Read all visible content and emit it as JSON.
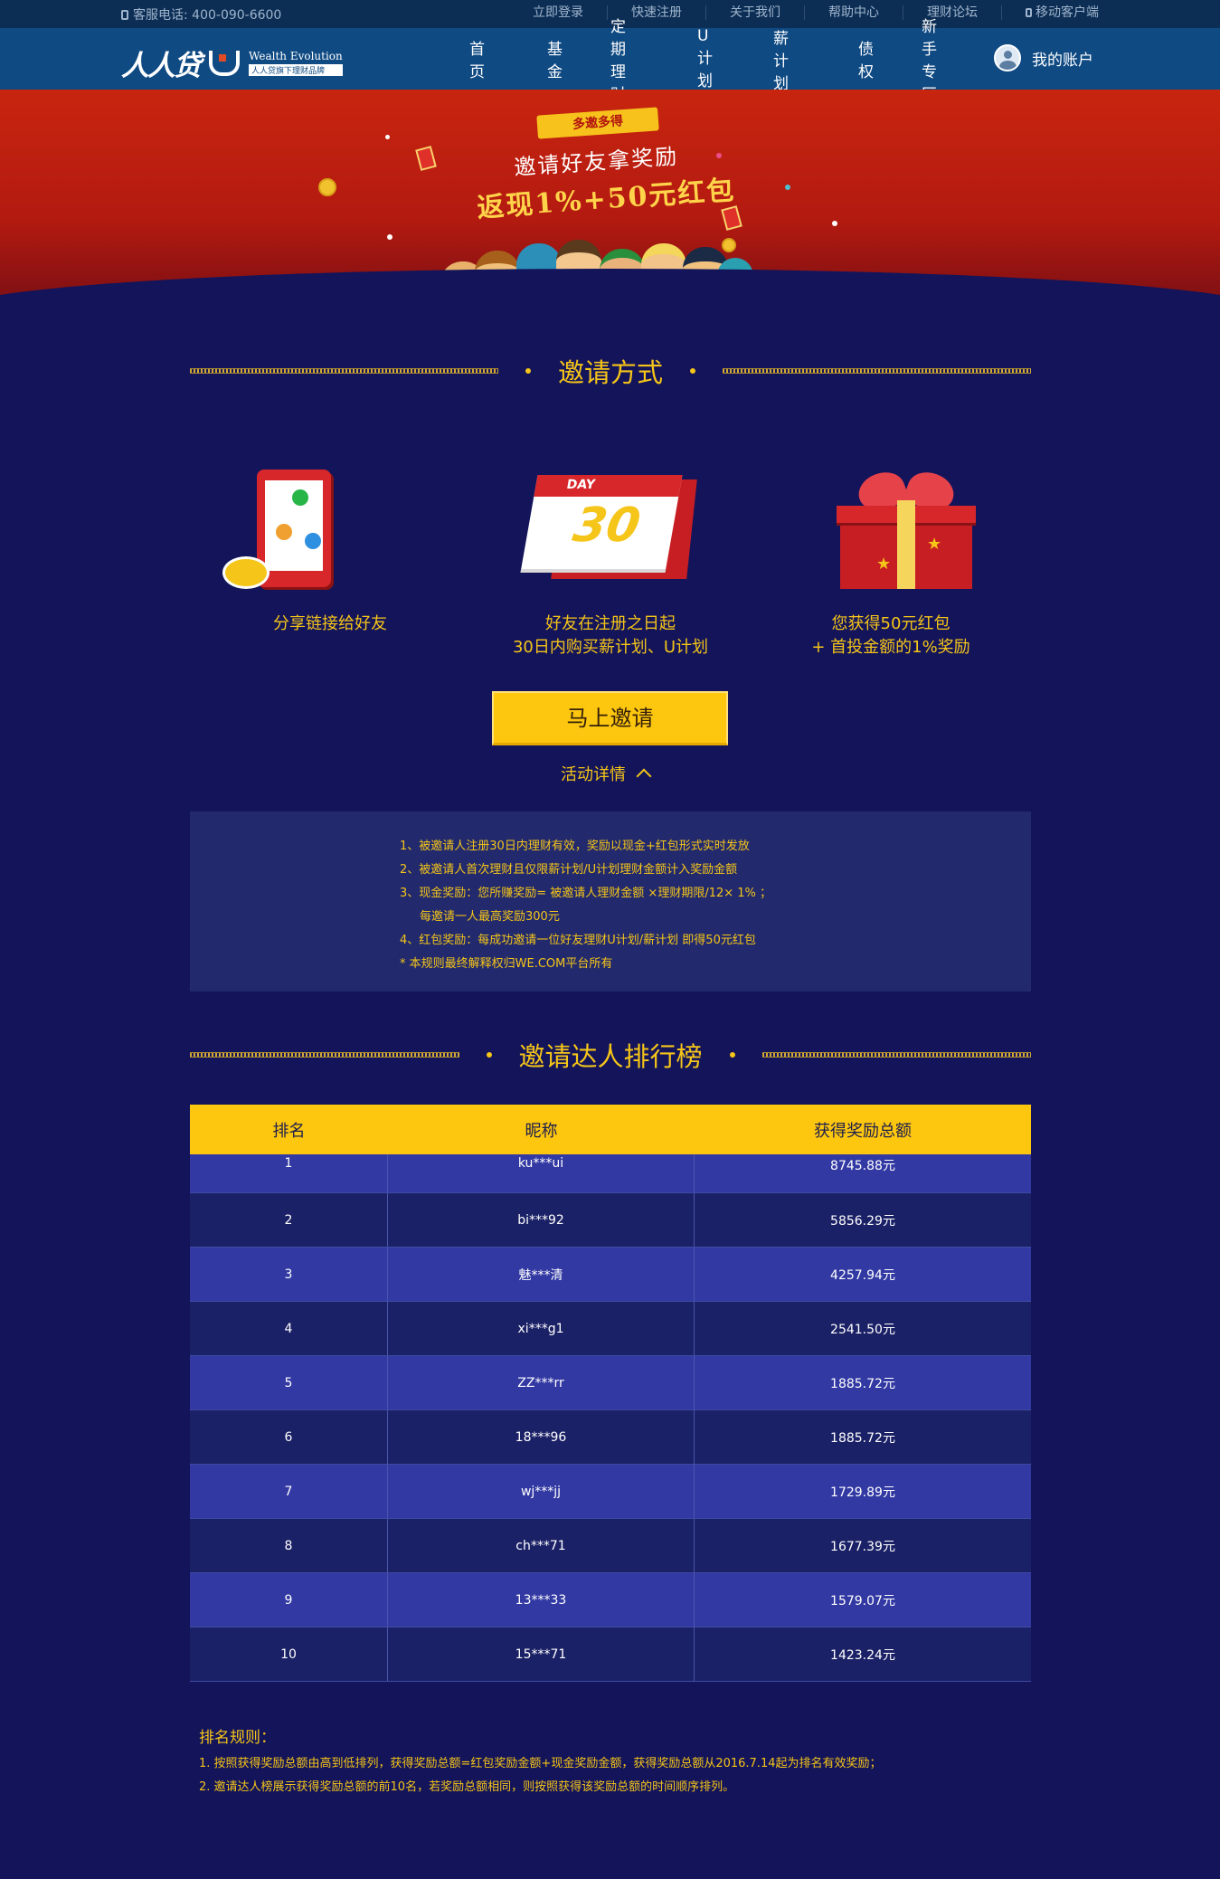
{
  "topbar": {
    "hotline": "客服电话: 400-090-6600",
    "links": [
      "立即登录",
      "快速注册",
      "关于我们",
      "帮助中心",
      "理财论坛",
      "移动客户端"
    ]
  },
  "nav": {
    "logo_cn": "人人贷",
    "logo_en": "Wealth Evolution",
    "logo_en_sub": "人人贷旗下理财品牌",
    "menu": [
      "首页",
      "基金",
      "定期理财",
      "U计划",
      "薪计划",
      "债权",
      "新手专区"
    ],
    "account": "我的账户"
  },
  "banner": {
    "ribbon": "多邀多得",
    "title": "邀请好友拿奖励",
    "subtitle": "返现1%+50元红包"
  },
  "invite_section": {
    "heading": "邀请方式",
    "steps": [
      {
        "icon": "phone-share-icon",
        "caption_lines": [
          "分享链接给好友"
        ]
      },
      {
        "icon": "calendar-icon",
        "calendar_day_label": "DAY",
        "calendar_number": "30",
        "caption_lines": [
          "好友在注册之日起",
          "30日内购买薪计划、U计划"
        ]
      },
      {
        "icon": "gift-icon",
        "caption_lines": [
          "您获得50元红包",
          "+ 首投金额的1%奖励"
        ]
      }
    ],
    "button": "马上邀请",
    "detail_link": "活动详情",
    "rules": [
      "1、被邀请人注册30日内理财有效，奖励以现金+红包形式实时发放",
      "2、被邀请人首次理财且仅限薪计划/U计划理财金额计入奖励金额",
      "3、现金奖励：您所赚奖励= 被邀请人理财金额 ×理财期限/12× 1% ；",
      "每邀请一人最高奖励300元",
      "4、红包奖励：每成功邀请一位好友理财U计划/薪计划 即得50元红包",
      "* 本规则最终解释权归WE.COM平台所有"
    ]
  },
  "ranking_section": {
    "heading": "邀请达人排行榜",
    "columns": [
      "排名",
      "昵称",
      "获得奖励总额"
    ],
    "rows": [
      [
        "1",
        "ku***ui",
        "8745.88元"
      ],
      [
        "2",
        "bi***92",
        "5856.29元"
      ],
      [
        "3",
        "魅***清",
        "4257.94元"
      ],
      [
        "4",
        "xi***g1",
        "2541.50元"
      ],
      [
        "5",
        "ZZ***rr",
        "1885.72元"
      ],
      [
        "6",
        "18***96",
        "1885.72元"
      ],
      [
        "7",
        "wj***jj",
        "1729.89元"
      ],
      [
        "8",
        "ch***71",
        "1677.39元"
      ],
      [
        "9",
        "13***33",
        "1579.07元"
      ],
      [
        "10",
        "15***71",
        "1423.24元"
      ]
    ],
    "rules_title": "排名规则：",
    "rules": [
      "1. 按照获得奖励总额由高到低排列，获得奖励总额=红包奖励金额+现金奖励金额，获得奖励总额从2016.7.14起为排名有效奖励；",
      "2. 邀请达人榜展示获得奖励总额的前10名，若奖励总额相同，则按照获得该奖励总额的时间顺序排列。"
    ]
  },
  "colors": {
    "page_bg": "#13145a",
    "accent_yellow": "#fdc60f",
    "nav_blue": "#0f4a83",
    "banner_red": "#c8250f"
  }
}
